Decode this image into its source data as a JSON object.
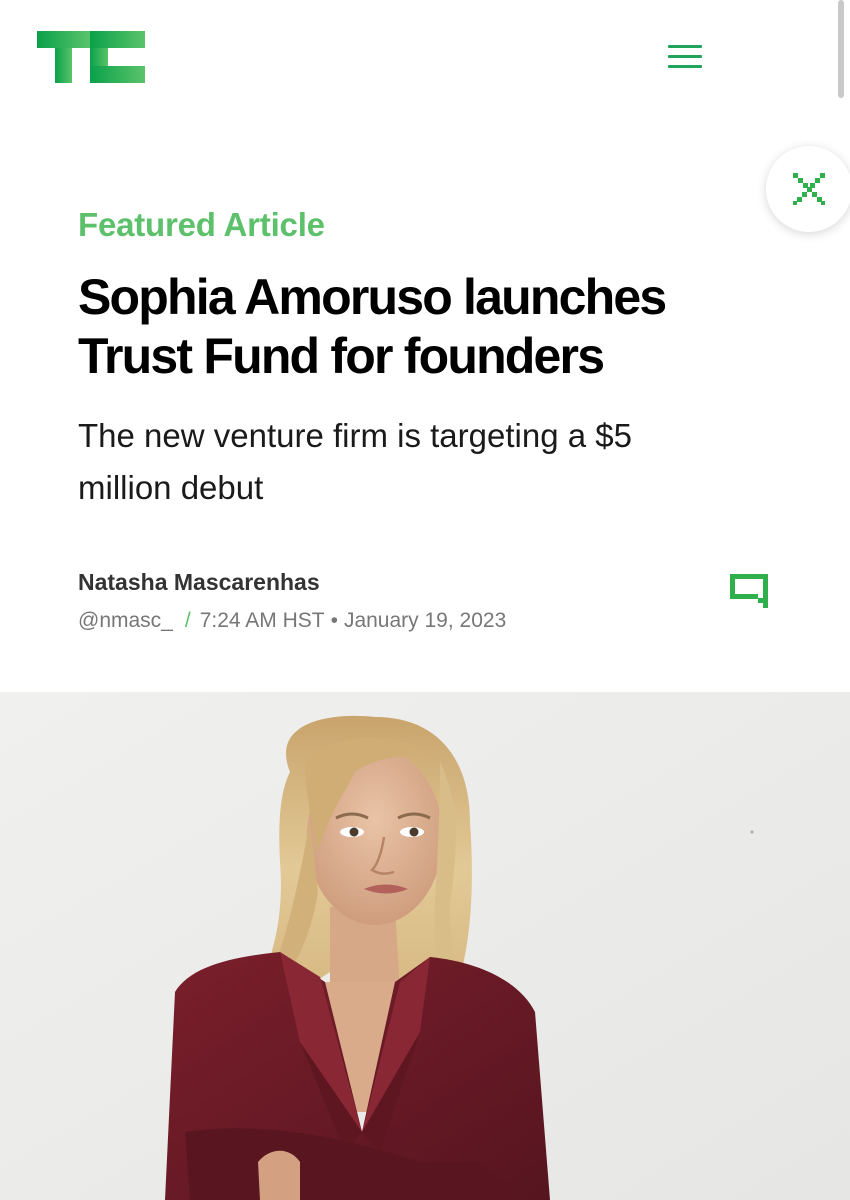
{
  "header": {
    "logo_text": "TC",
    "menu_icon": "hamburger-menu-icon"
  },
  "overlay": {
    "close_icon": "close-icon"
  },
  "article": {
    "kicker": "Featured Article",
    "headline": "Sophia Amoruso launches Trust Fund for founders",
    "subheadline": "The new venture firm is targeting a $5 million debut",
    "author": "Natasha Mascarenhas",
    "handle": "@nmasc_",
    "separator": "/",
    "time": "7:24 AM HST",
    "bullet": "•",
    "date": "January 19, 2023",
    "comment_icon": "comment-icon"
  },
  "colors": {
    "brand_green": "#0a9e01",
    "accent_green": "#5cc16a",
    "text": "#000000",
    "meta_text": "#777777",
    "blazer": "#6b1a24"
  }
}
